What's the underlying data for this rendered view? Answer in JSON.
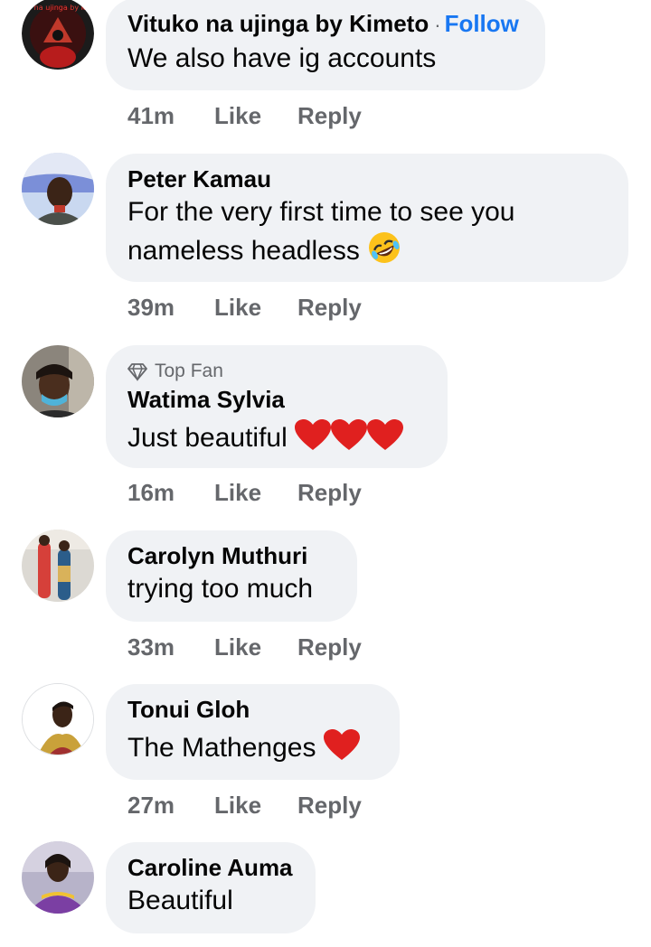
{
  "comments": [
    {
      "author": "Vituko na ujinga by Kimeto",
      "follow": "Follow",
      "follow_sep": "·",
      "text": "We also have ig accounts",
      "time": "41m",
      "avatar_label": "vituko na ujinga by kimeto"
    },
    {
      "author": "Peter Kamau",
      "text_line1": "For the very first time to see you",
      "text_line2": "nameless headless",
      "emoji": "rolling-on-floor-laughing",
      "time": "39m"
    },
    {
      "badge": "Top Fan",
      "author": "Watima Sylvia",
      "text": "Just beautiful",
      "emoji": "red-heart x3",
      "time": "16m"
    },
    {
      "author": "Carolyn Muthuri",
      "text": "trying too much",
      "time": "33m"
    },
    {
      "author": "Tonui Gloh",
      "text": "The Mathenges",
      "emoji": "red-heart",
      "time": "27m"
    },
    {
      "author": "Caroline Auma",
      "text": "Beautiful"
    }
  ],
  "actions": {
    "like": "Like",
    "reply": "Reply"
  },
  "colors": {
    "bubble": "#f0f2f5",
    "link": "#1877f2",
    "meta": "#65676b",
    "text": "#050505"
  }
}
